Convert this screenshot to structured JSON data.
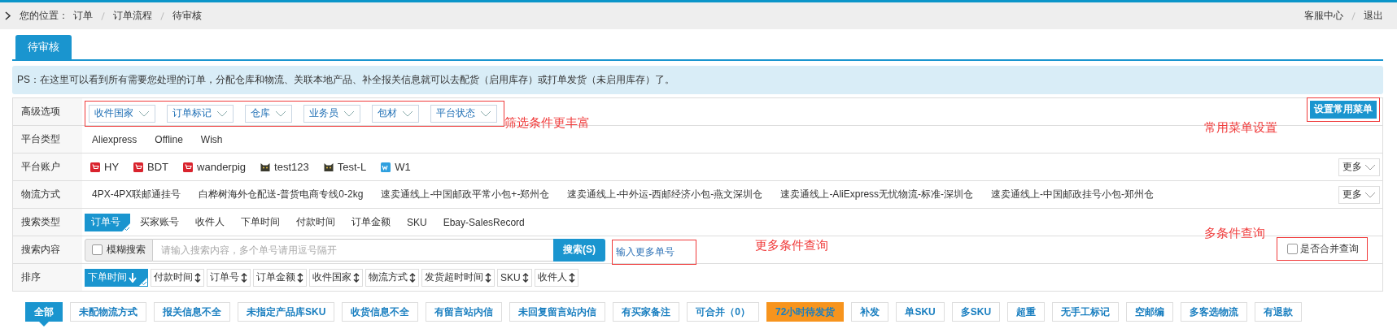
{
  "breadcrumb": {
    "label": "您的位置：",
    "items": [
      "订单",
      "订单流程",
      "待审核"
    ]
  },
  "top_links": [
    "客服中心",
    "退出"
  ],
  "tabs": [
    {
      "label": "待审核",
      "selected": true
    }
  ],
  "notice": "PS：在这里可以看到所有需要您处理的订单，分配仓库和物流、关联本地产品、补全报关信息就可以去配货（启用库存）或打单发货（未启用库存）了。",
  "filters": {
    "advanced": {
      "label": "高级选项",
      "dropdowns": [
        "收件国家",
        "订单标记",
        "仓库",
        "业务员",
        "包材",
        "平台状态"
      ],
      "button": "设置常用菜单"
    },
    "platform_type": {
      "label": "平台类型",
      "options": [
        "Aliexpress",
        "Offline",
        "Wish"
      ]
    },
    "accounts": {
      "label": "平台账户",
      "items": [
        {
          "name": "HY",
          "kind": "aliexpress"
        },
        {
          "name": "BDT",
          "kind": "aliexpress"
        },
        {
          "name": "wanderpig",
          "kind": "aliexpress"
        },
        {
          "name": "test123",
          "kind": "cat"
        },
        {
          "name": "Test-L",
          "kind": "cat"
        },
        {
          "name": "W1",
          "kind": "wish"
        }
      ],
      "more": "更多"
    },
    "shipping": {
      "label": "物流方式",
      "options": [
        "4PX-4PX联邮通挂号",
        "白桦树海外仓配送-普货电商专线0-2kg",
        "速卖通线上-中国邮政平常小包+-郑州仓",
        "速卖通线上-中外运-西邮经济小包-燕文深圳仓",
        "速卖通线上-AliExpress无忧物流-标准-深圳仓",
        "速卖通线上-中国邮政挂号小包-郑州仓"
      ],
      "more": "更多"
    },
    "search_type": {
      "label": "搜索类型",
      "options": [
        {
          "label": "订单号",
          "selected": true
        },
        {
          "label": "买家账号",
          "selected": false
        },
        {
          "label": "收件人",
          "selected": false
        },
        {
          "label": "下单时间",
          "selected": false
        },
        {
          "label": "付款时间",
          "selected": false
        },
        {
          "label": "订单金额",
          "selected": false
        },
        {
          "label": "SKU",
          "selected": false
        },
        {
          "label": "Ebay-SalesRecord",
          "selected": false
        }
      ]
    },
    "search": {
      "label": "搜索内容",
      "fuzzy": {
        "label": "模糊搜索",
        "checked": false
      },
      "placeholder": "请输入搜索内容，多个单号请用逗号隔开",
      "button": "搜索(S)",
      "more_link": "输入更多单号",
      "merge": {
        "label": "是否合并查询",
        "checked": false
      }
    },
    "sort": {
      "label": "排序",
      "options": [
        {
          "label": "下单时间",
          "selected": true
        },
        {
          "label": "付款时间",
          "selected": false
        },
        {
          "label": "订单号",
          "selected": false
        },
        {
          "label": "订单金额",
          "selected": false
        },
        {
          "label": "收件国家",
          "selected": false
        },
        {
          "label": "物流方式",
          "selected": false
        },
        {
          "label": "发货超时时间",
          "selected": false
        },
        {
          "label": "SKU",
          "selected": false
        },
        {
          "label": "收件人",
          "selected": false
        }
      ]
    }
  },
  "status_tabs": [
    {
      "label": "全部",
      "selected": true,
      "highlighted": false
    },
    {
      "label": "未配物流方式",
      "selected": false,
      "highlighted": false
    },
    {
      "label": "报关信息不全",
      "selected": false,
      "highlighted": false
    },
    {
      "label": "未指定产品库SKU",
      "selected": false,
      "highlighted": false
    },
    {
      "label": "收货信息不全",
      "selected": false,
      "highlighted": false
    },
    {
      "label": "有留言站内信",
      "selected": false,
      "highlighted": false
    },
    {
      "label": "未回复留言站内信",
      "selected": false,
      "highlighted": false
    },
    {
      "label": "有买家备注",
      "selected": false,
      "highlighted": false
    },
    {
      "label": "可合并（0）",
      "selected": false,
      "highlighted": false
    },
    {
      "label": "72小时待发货",
      "selected": false,
      "highlighted": true
    },
    {
      "label": "补发",
      "selected": false,
      "highlighted": false
    },
    {
      "label": "单SKU",
      "selected": false,
      "highlighted": false
    },
    {
      "label": "多SKU",
      "selected": false,
      "highlighted": false
    },
    {
      "label": "超重",
      "selected": false,
      "highlighted": false
    },
    {
      "label": "无手工标记",
      "selected": false,
      "highlighted": false
    },
    {
      "label": "空邮编",
      "selected": false,
      "highlighted": false
    },
    {
      "label": "多客选物流",
      "selected": false,
      "highlighted": false
    },
    {
      "label": "有退款",
      "selected": false,
      "highlighted": false
    }
  ],
  "annotations": [
    "筛选条件更丰富",
    "常用菜单设置",
    "多条件查询",
    "更多条件查询"
  ]
}
